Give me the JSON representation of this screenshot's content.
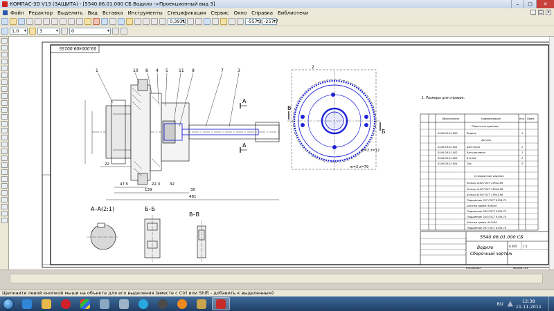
{
  "window": {
    "title": "КОМПАС-3D V13 (ЗАЩИТА) - [5540.06.01.000 СБ Водило ->Проекционный вид 3]",
    "minimize": "–",
    "maximize": "□",
    "close": "✕"
  },
  "menu": {
    "items": [
      "Файл",
      "Редактор",
      "Выделить",
      "Вид",
      "Вставка",
      "Инструменты",
      "Спецификация",
      "Сервис",
      "Окно",
      "Справка",
      "Библиотеки"
    ],
    "doc_min": "_",
    "doc_max": "□",
    "doc_close": "x"
  },
  "toolbar": {
    "scale_value": "0.3931",
    "coord_x": "-557.2",
    "coord_y": "-257.7",
    "line_width": "1.0",
    "layer": "3",
    "style": "0"
  },
  "drawing": {
    "stamp_code": "93.000409.00155",
    "note": "1. Размеры для справок.",
    "designation": "5540.06.01.000 СБ",
    "part_name_1": "Водило",
    "part_name_2": "Сборочный чертеж",
    "section_aa": "А–А(2:1)",
    "section_bb": "Б–Б",
    "section_vv": "В–В",
    "label_a": "А",
    "label_b": "Б",
    "label_v": "В",
    "label_2": "2",
    "dim_481": "481",
    "dim_139": "139",
    "dim_473": "47.5",
    "dim_30": "30",
    "dim_223": "22.3",
    "dim_32": "32",
    "dim_22": "22",
    "dim_m": "m=2 z=79",
    "dim_m2": "m=2 z=12",
    "leaders": [
      "1",
      "10",
      "8",
      "4",
      "5",
      "11",
      "9",
      "7",
      "3"
    ],
    "spec_headers": [
      "Обозначение",
      "Наименование",
      "Кол.",
      "Прим."
    ],
    "spec_sections": [
      "Сборочные единицы",
      "Детали",
      "Стандартные изделия"
    ],
    "spec_rows_parts": [
      [
        "5540.06.01.000",
        "Водило",
        "1"
      ],
      [
        "5540.06.01.001",
        "Шестерня",
        "2"
      ],
      [
        "5540.06.01.002",
        "Вал-шестерня",
        "1"
      ],
      [
        "5540.06.01.003",
        "Втулка",
        "2"
      ],
      [
        "5540.06.01.004",
        "Ось",
        "2"
      ]
    ],
    "spec_rows_std": [
      "Кольцо А.62 ГОСТ 13942-86",
      "Кольцо А.42 ГОСТ 13942-86",
      "Кольцо В.50 ГОСТ 13943-86",
      "Подшипник 307 ГОСТ 8338-75",
      "Шпонка призм. 6х6х20",
      "Подшипник 205 ГОСТ 8338-75",
      "Подшипник 204 ГОСТ 8338-75",
      "Шпонка призм. 8х7х28",
      "Подшипник 207 ГОСТ 8338-75",
      "Подшипник 304 ГОСТ 8338-75"
    ],
    "sheet_scale": "1:1",
    "sheet_mass": "0.005",
    "sheet_copy": "Копировал",
    "sheet_format": "Формат А1"
  },
  "status_text": "Щелкните левой кнопкой мыши на объекте для его выделения (вместе с Ctrl или Shift - добавить к выделенным)",
  "tray": {
    "lang": "RU",
    "time": "12:38",
    "date": "11.11.2011"
  },
  "colors": {
    "selected": "#1e24d8",
    "line": "#000000",
    "paper": "#ffffff"
  }
}
